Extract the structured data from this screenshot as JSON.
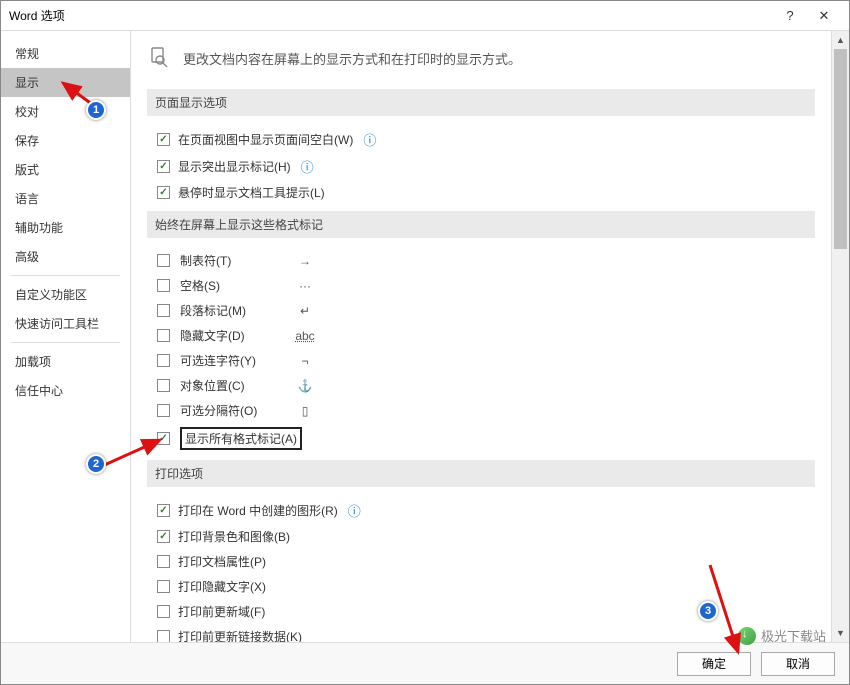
{
  "title": "Word 选项",
  "titlebar": {
    "help": "?",
    "close": "✕"
  },
  "sidebar": {
    "items": [
      {
        "label": "常规"
      },
      {
        "label": "显示"
      },
      {
        "label": "校对"
      },
      {
        "label": "保存"
      },
      {
        "label": "版式"
      },
      {
        "label": "语言"
      },
      {
        "label": "辅助功能"
      },
      {
        "label": "高级"
      }
    ],
    "items2": [
      {
        "label": "自定义功能区"
      },
      {
        "label": "快速访问工具栏"
      }
    ],
    "items3": [
      {
        "label": "加载项"
      },
      {
        "label": "信任中心"
      }
    ]
  },
  "header": {
    "text": "更改文档内容在屏幕上的显示方式和在打印时的显示方式。"
  },
  "sections": {
    "page_display": {
      "title": "页面显示选项",
      "opts": [
        {
          "label": "在页面视图中显示页面间空白(W)",
          "checked": true,
          "info": true
        },
        {
          "label": "显示突出显示标记(H)",
          "checked": true,
          "info": true
        },
        {
          "label": "悬停时显示文档工具提示(L)",
          "checked": true,
          "info": false
        }
      ]
    },
    "marks": {
      "title": "始终在屏幕上显示这些格式标记",
      "items": [
        {
          "label": "制表符(T)",
          "sym": "→",
          "checked": false
        },
        {
          "label": "空格(S)",
          "sym": "···",
          "checked": false
        },
        {
          "label": "段落标记(M)",
          "sym": "↵",
          "checked": false
        },
        {
          "label": "隐藏文字(D)",
          "sym": "abc",
          "checked": false
        },
        {
          "label": "可选连字符(Y)",
          "sym": "¬",
          "checked": false
        },
        {
          "label": "对象位置(C)",
          "sym": "⚓",
          "checked": false
        },
        {
          "label": "可选分隔符(O)",
          "sym": "▯",
          "checked": false
        }
      ],
      "show_all": {
        "label": "显示所有格式标记(A)",
        "checked": true
      }
    },
    "print": {
      "title": "打印选项",
      "items": [
        {
          "label": "打印在 Word 中创建的图形(R)",
          "checked": true,
          "info": true
        },
        {
          "label": "打印背景色和图像(B)",
          "checked": true,
          "info": false
        },
        {
          "label": "打印文档属性(P)",
          "checked": false,
          "info": false
        },
        {
          "label": "打印隐藏文字(X)",
          "checked": false,
          "info": false
        },
        {
          "label": "打印前更新域(F)",
          "checked": false,
          "info": false
        },
        {
          "label": "打印前更新链接数据(K)",
          "checked": false,
          "info": false
        }
      ]
    }
  },
  "footer": {
    "ok": "确定",
    "cancel": "取消"
  },
  "annotations": {
    "b1": "1",
    "b2": "2",
    "b3": "3"
  },
  "watermark": "极光下载站"
}
